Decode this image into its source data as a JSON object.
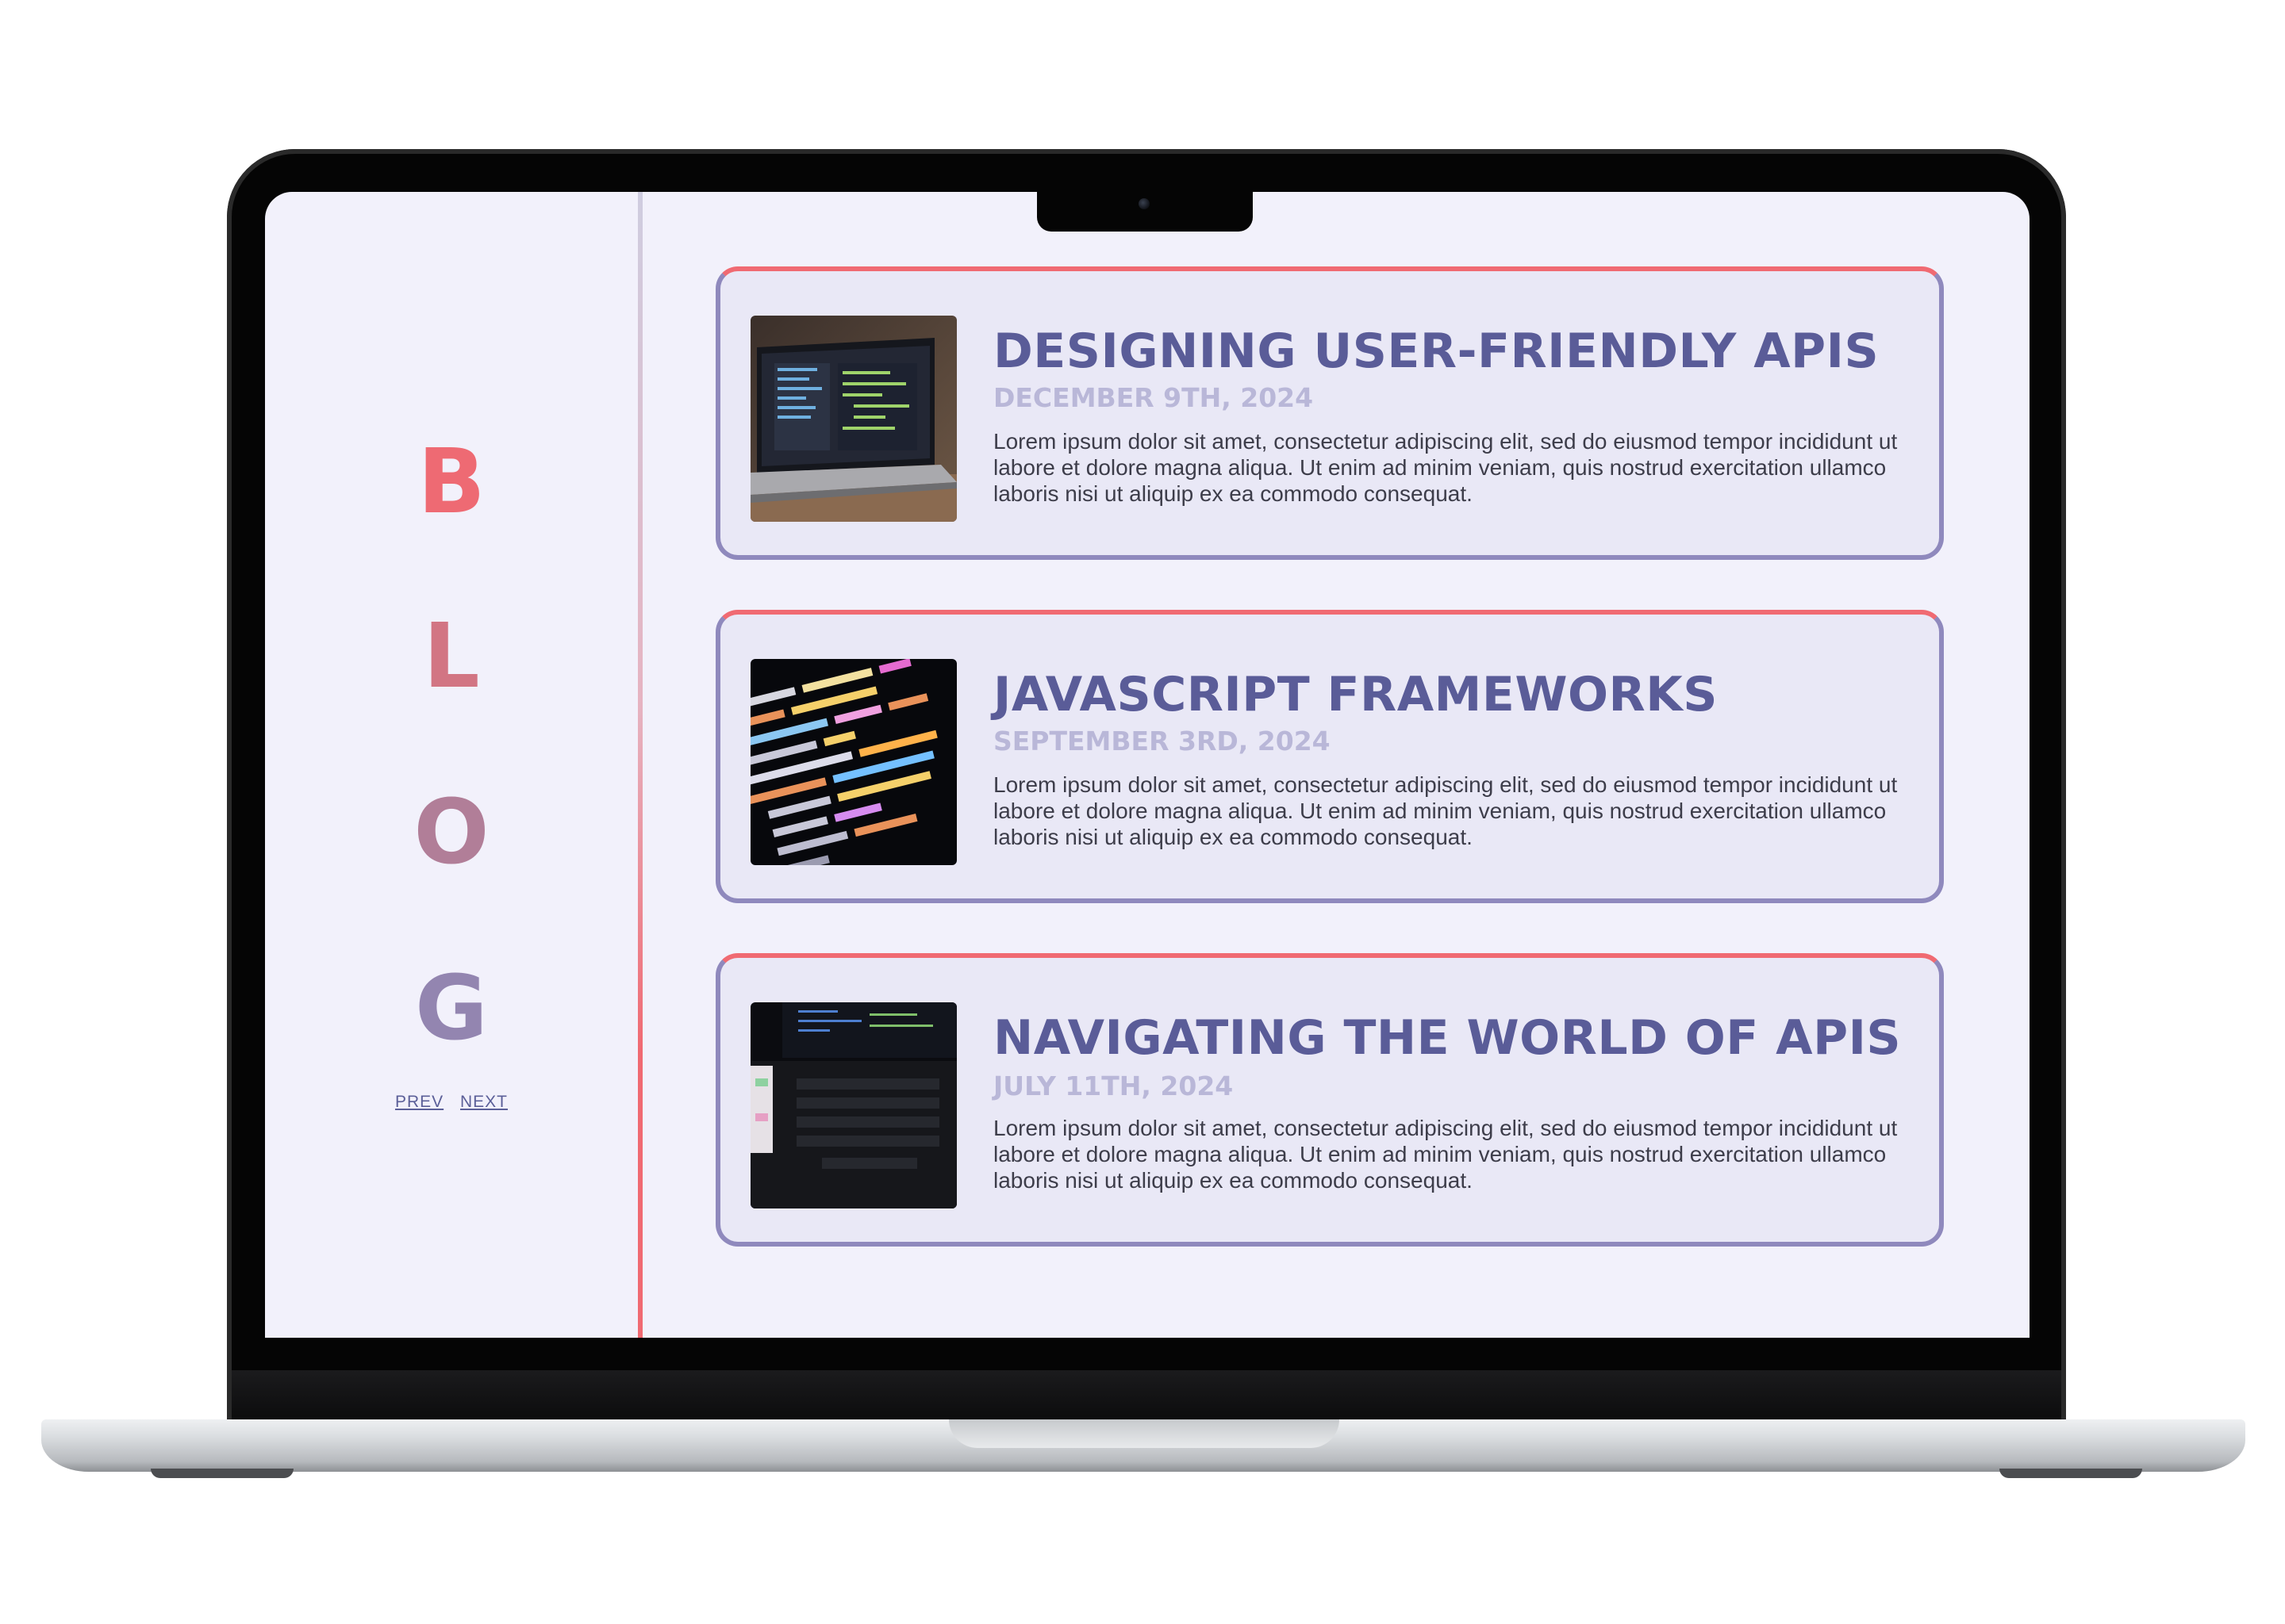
{
  "sidebar": {
    "letters": [
      "B",
      "L",
      "O",
      "G"
    ],
    "letter_colors": [
      "#ee6a73",
      "#d27583",
      "#b17e98",
      "#9385b0"
    ],
    "prev_label": "PREV",
    "next_label": "NEXT"
  },
  "posts": [
    {
      "title": "DESIGNING USER-FRIENDLY APIS",
      "date": "DECEMBER 9TH, 2024",
      "excerpt": "Lorem ipsum dolor sit amet, consectetur adipiscing elit, sed do eiusmod tempor incididunt ut labore et dolore magna aliqua. Ut enim ad minim veniam, quis nostrud exercitation ullamco laboris nisi ut aliquip ex ea commodo consequat.",
      "image": "laptop-code-photo"
    },
    {
      "title": "JAVASCRIPT FRAMEWORKS",
      "date": "SEPTEMBER 3RD, 2024",
      "excerpt": "Lorem ipsum dolor sit amet, consectetur adipiscing elit, sed do eiusmod tempor incididunt ut labore et dolore magna aliqua. Ut enim ad minim veniam, quis nostrud exercitation ullamco laboris nisi ut aliquip ex ea commodo consequat.",
      "image": "code-closeup-photo"
    },
    {
      "title": "NAVIGATING THE WORLD OF APIS",
      "date": "JULY 11TH, 2024",
      "excerpt": "Lorem ipsum dolor sit amet, consectetur adipiscing elit, sed do eiusmod tempor incididunt ut labore et dolore magna aliqua. Ut enim ad minim veniam, quis nostrud exercitation ullamco laboris nisi ut aliquip ex ea commodo consequat.",
      "image": "dark-laptop-photo"
    }
  ],
  "colors": {
    "accent": "#f06a72",
    "title": "#5a5c98",
    "date": "#b9b7d8",
    "card_bg": "#e9e8f6",
    "page_bg": "#f2f1fb"
  }
}
